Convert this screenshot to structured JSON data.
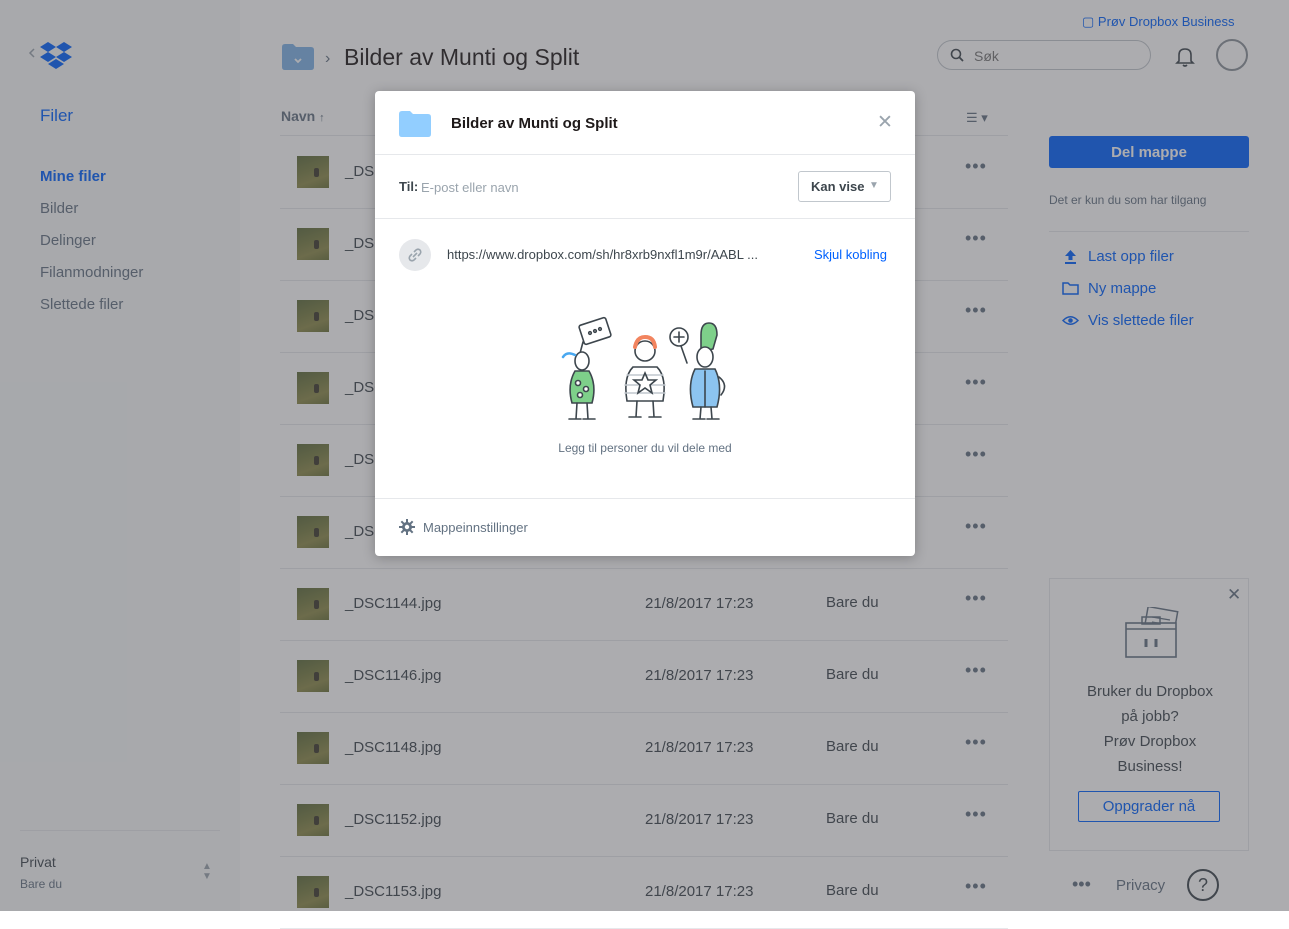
{
  "header": {
    "business_link": "Prøv Dropbox Business",
    "search_placeholder": "Søk",
    "breadcrumb_title": "Bilder av Munti og Split"
  },
  "sidebar": {
    "title": "Filer",
    "items": [
      {
        "label": "Mine filer",
        "active": true
      },
      {
        "label": "Bilder",
        "active": false
      },
      {
        "label": "Delinger",
        "active": false
      },
      {
        "label": "Filanmodninger",
        "active": false
      },
      {
        "label": "Slettede filer",
        "active": false
      }
    ],
    "account": {
      "name": "Privat",
      "sub": "Bare du"
    }
  },
  "file_list": {
    "column_name": "Navn",
    "sort_indicator": "↑",
    "rows": [
      {
        "name": "_DSC",
        "date": "",
        "members": ""
      },
      {
        "name": "_DSC",
        "date": "",
        "members": ""
      },
      {
        "name": "_DSC",
        "date": "",
        "members": ""
      },
      {
        "name": "_DSC",
        "date": "",
        "members": ""
      },
      {
        "name": "_DSC",
        "date": "",
        "members": ""
      },
      {
        "name": "_DSC",
        "date": "",
        "members": ""
      },
      {
        "name": "_DSC1144.jpg",
        "date": "21/8/2017 17:23",
        "members": "Bare du"
      },
      {
        "name": "_DSC1146.jpg",
        "date": "21/8/2017 17:23",
        "members": "Bare du"
      },
      {
        "name": "_DSC1148.jpg",
        "date": "21/8/2017 17:23",
        "members": "Bare du"
      },
      {
        "name": "_DSC1152.jpg",
        "date": "21/8/2017 17:23",
        "members": "Bare du"
      },
      {
        "name": "_DSC1153.jpg",
        "date": "21/8/2017 17:23",
        "members": "Bare du"
      }
    ]
  },
  "right_panel": {
    "share_button": "Del mappe",
    "access_note": "Det er kun du som har tilgang",
    "actions": [
      {
        "label": "Last opp filer",
        "icon": "upload-icon"
      },
      {
        "label": "Ny mappe",
        "icon": "folder-icon"
      },
      {
        "label": "Vis slettede filer",
        "icon": "eye-icon"
      }
    ],
    "promo": {
      "lines": [
        "Bruker du Dropbox",
        "på jobb?",
        "Prøv Dropbox",
        "Business!"
      ],
      "button": "Oppgrader nå"
    },
    "footer": {
      "privacy": "Privacy",
      "help": "?"
    }
  },
  "modal": {
    "title": "Bilder av Munti og Split",
    "to_label": "Til:",
    "to_placeholder": "E-post eller navn",
    "permission": "Kan vise",
    "link_url": "https://www.dropbox.com/sh/hr8xrb9nxfl1m9r/AABL ...",
    "hide_link": "Skjul kobling",
    "empty_text": "Legg til personer du vil dele med",
    "settings": "Mappeinnstillinger"
  },
  "colors": {
    "accent": "#0061fe",
    "folder": "#92ceff",
    "overlay": "#46484e"
  }
}
